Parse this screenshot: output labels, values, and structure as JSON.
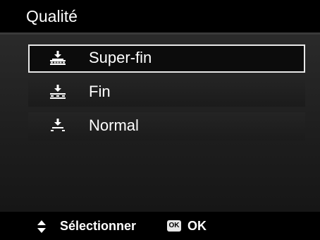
{
  "header": {
    "title": "Qualité"
  },
  "menu": {
    "items": [
      {
        "label": "Super-fin",
        "icon": "quality-superfine-icon",
        "selected": true
      },
      {
        "label": "Fin",
        "icon": "quality-fine-icon",
        "selected": false
      },
      {
        "label": "Normal",
        "icon": "quality-normal-icon",
        "selected": false
      }
    ]
  },
  "footer": {
    "navigate_icon": "up-down-arrows-icon",
    "select_label": "Sélectionner",
    "ok_badge": "OK",
    "ok_label": "OK"
  },
  "colors": {
    "background": "#1a1a1a",
    "title_bar": "#000000",
    "selection_border": "#e8e8e8",
    "text": "#ffffff"
  }
}
